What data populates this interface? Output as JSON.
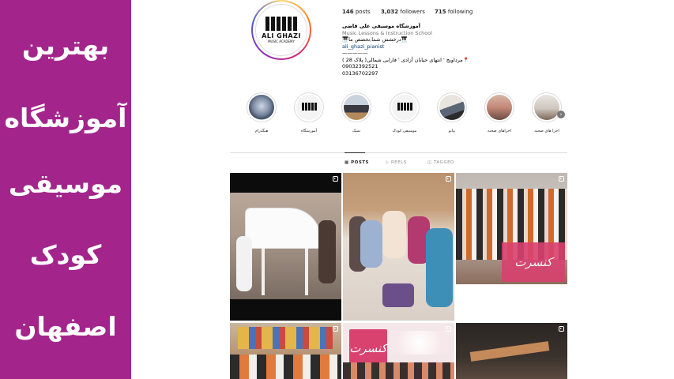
{
  "side_banner": {
    "bg": "#a3258b",
    "lines": [
      "بهترین",
      "آموزشگاه",
      "موسیقی",
      "کودک",
      "اصفهان"
    ]
  },
  "profile": {
    "avatar_text_top": "ALI GHAZI",
    "avatar_text_bottom": "MUSIC ACADEMY",
    "stats": {
      "posts_count": "146",
      "posts_label": "posts",
      "followers_count": "3,032",
      "followers_label": "followers",
      "following_count": "715",
      "following_label": "following"
    },
    "bio": {
      "name": "آموزشگاه موسیقی علی قاضی",
      "category": "Music Lessons & Instruction School",
      "line3": "🎹درخشش شما,تخصص ما🎹",
      "link": "ali_ghazi_pianist",
      "dashes": "—————",
      "address": "📍مرداویج ' انتهای خیابان آزادی ' فارابی شمالی( پلاک 28 )",
      "phone1": "09032392521",
      "phone2": "03136702297"
    }
  },
  "highlights": [
    {
      "label": "هنگدرام",
      "icon": "handpan-icon"
    },
    {
      "label": "آموزشگاه",
      "icon": "piano-logo-icon"
    },
    {
      "label": "تمبک",
      "icon": "tombak-icon"
    },
    {
      "label": "موسیقی کودک",
      "icon": "piano-logo-icon"
    },
    {
      "label": "پیانو",
      "icon": "piano-icon"
    },
    {
      "label": "اجراهای صحنه",
      "icon": "stage-icon"
    },
    {
      "label": "اجرا های صحنه",
      "icon": "stage-icon"
    }
  ],
  "tabs": [
    {
      "label": "POSTS",
      "active": true
    },
    {
      "label": "REELS",
      "active": false
    },
    {
      "label": "TAGGED",
      "active": false
    }
  ],
  "posts": [
    {
      "overlay": "",
      "type": "reel"
    },
    {
      "overlay": "",
      "type": "reel"
    },
    {
      "overlay": "کنسرت",
      "type": "reel"
    },
    {
      "overlay": "",
      "type": "reel"
    },
    {
      "overlay": "کنسرت",
      "type": "reel"
    },
    {
      "overlay": "",
      "type": "reel"
    }
  ],
  "colors": {
    "accent_banner": "#a3258b",
    "overlay_pink": "#d9416f",
    "link_blue": "#00376b"
  }
}
